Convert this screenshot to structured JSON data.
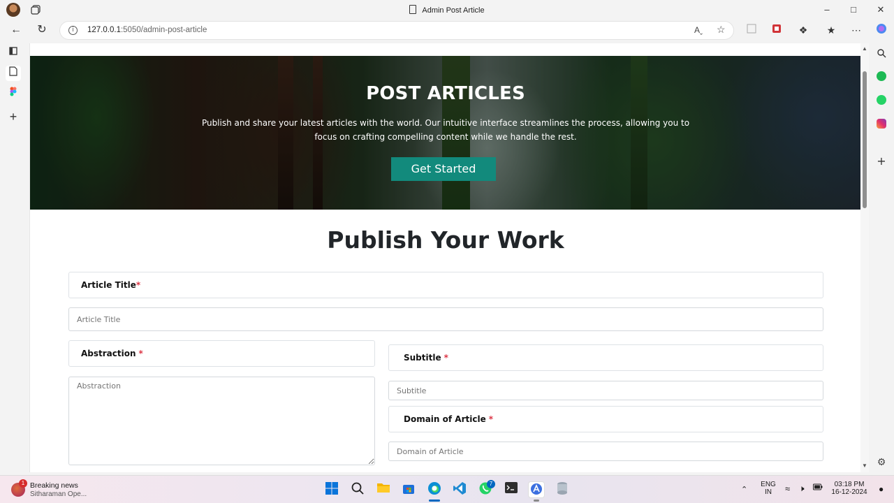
{
  "browser": {
    "window_title": "Admin Post Article",
    "url_host": "127.0.0.1",
    "url_rest": ":5050/admin-post-article",
    "read_aloud": "Aˬ"
  },
  "hero": {
    "title": "POST ARTICLES",
    "description": "Publish and share your latest articles with the world. Our intuitive interface streamlines the process, allowing you to focus on crafting compelling content while we handle the rest.",
    "button": "Get Started",
    "button_color": "#128a7c"
  },
  "form": {
    "heading": "Publish Your Work",
    "required_mark": "*",
    "article_title": {
      "label": "Article Title",
      "placeholder": "Article Title"
    },
    "abstraction": {
      "label": "Abstraction",
      "placeholder": "Abstraction"
    },
    "subtitle": {
      "label": "Subtitle",
      "placeholder": "Subtitle"
    },
    "domain": {
      "label": "Domain of Article",
      "placeholder": "Domain of Article"
    }
  },
  "taskbar": {
    "news_title": "Breaking news",
    "news_sub": "Sitharaman Ope...",
    "news_badge": "1",
    "whatsapp_badge": "7",
    "lang_line1": "ENG",
    "lang_line2": "IN",
    "time": "03:18 PM",
    "date": "16-12-2024"
  }
}
